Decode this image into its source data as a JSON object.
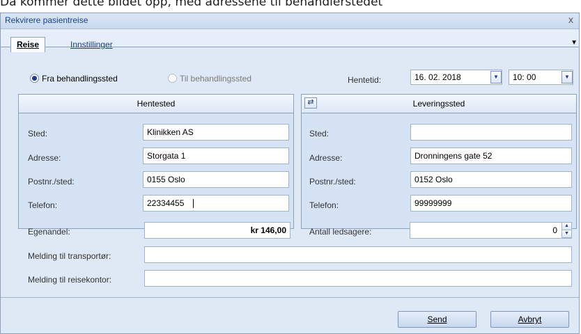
{
  "caption": "Da kommer dette bildet opp, med adressene til behandlerstedet",
  "window": {
    "title": "Rekvirere pasientreise",
    "close_glyph": "x"
  },
  "tabs": [
    {
      "label": "Reise",
      "active": true
    },
    {
      "label": "Innstillinger",
      "active": false
    }
  ],
  "tab_overflow_glyph": "▼",
  "direction": {
    "option_from": "Fra behandlingssted",
    "option_to": "Til behandlingssted",
    "selected": "Fra behandlingssted"
  },
  "pickup_time": {
    "label": "Hentetid:",
    "date": "16. 02. 2018",
    "time": "10: 00"
  },
  "pickup": {
    "title": "Hentested",
    "place_label": "Sted:",
    "place": "Klinikken AS",
    "address_label": "Adresse:",
    "address": "Storgata 1",
    "postal_label": "Postnr./sted:",
    "postal": "0155 Oslo",
    "phone_label": "Telefon:",
    "phone": "22334455"
  },
  "delivery": {
    "title": "Leveringssted",
    "place_label": "Sted:",
    "place": "",
    "address_label": "Adresse:",
    "address": "Dronningens gate 52",
    "postal_label": "Postnr./sted:",
    "postal": "0152 Oslo",
    "phone_label": "Telefon:",
    "phone": "99999999"
  },
  "extras": {
    "copay_label": "Egenandel:",
    "copay_value": "kr 146,00",
    "escorts_label": "Antall ledsagere:",
    "escorts_value": "0",
    "msg_transport_label": "Melding til transportør:",
    "msg_transport_value": "",
    "msg_office_label": "Melding til reisekontor:",
    "msg_office_value": ""
  },
  "buttons": {
    "send": "Send",
    "cancel": "Avbryt"
  },
  "colors": {
    "accent": "#15428b",
    "panel": "#d5e3f5",
    "border": "#8ba0bc"
  }
}
